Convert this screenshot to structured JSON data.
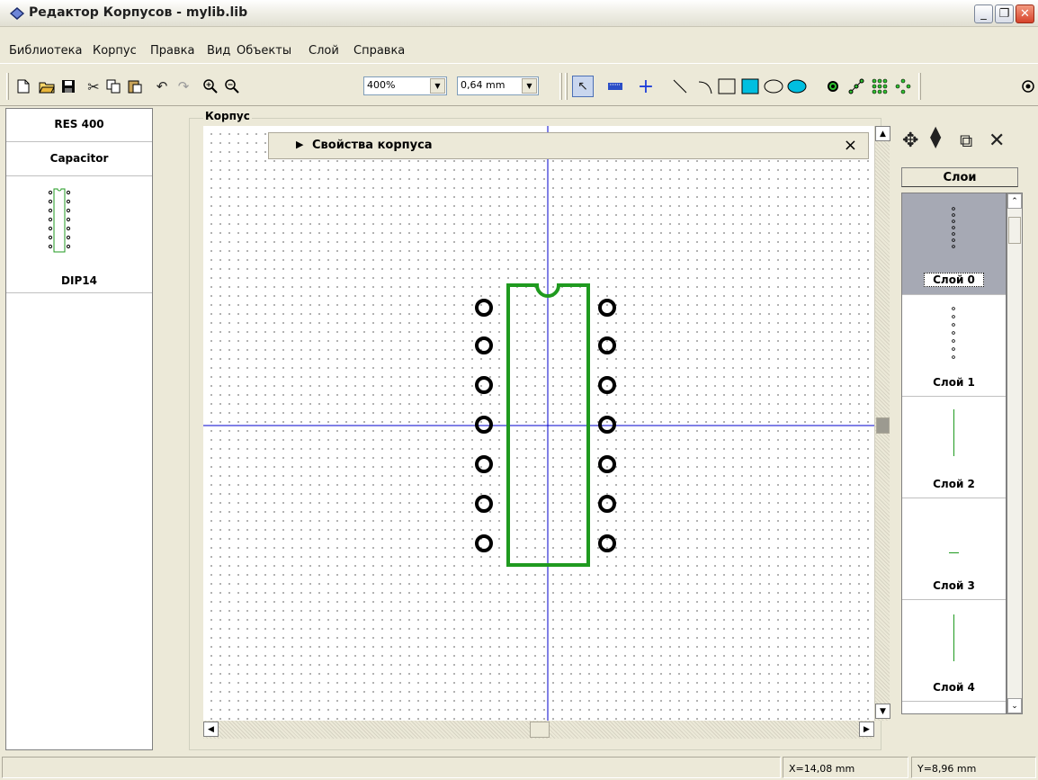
{
  "window": {
    "title": "Редактор Корпусов - mylib.lib",
    "min_label": "_",
    "max_label": "❐",
    "close_label": "✕"
  },
  "menu": [
    "Библиотека",
    "Корпус",
    "Правка",
    "Вид",
    "Объекты",
    "Слой",
    "Справка"
  ],
  "toolbar": {
    "zoom": "400%",
    "grid_step": "0,64 mm"
  },
  "library_panel": {
    "items": [
      "RES 400",
      "Capacitor"
    ],
    "preview_name": "DIP14"
  },
  "workspace": {
    "group_title": "Корпус",
    "properties_title": "Свойства корпуса",
    "properties_close": "×"
  },
  "component": {
    "name": "DIP14",
    "pin_rows": 7,
    "pin_columns": 2,
    "outline_color": "#1f9a1f",
    "pad_color": "#000000",
    "crosshair_color": "#0000cc"
  },
  "layers": {
    "header": "Слои",
    "items": [
      "Слой 0",
      "Слой 1",
      "Слой 2",
      "Слой 3",
      "Слой 4"
    ],
    "selected": "Слой 0"
  },
  "status": {
    "x": "X=14,08 mm",
    "y": "Y=8,96 mm"
  }
}
